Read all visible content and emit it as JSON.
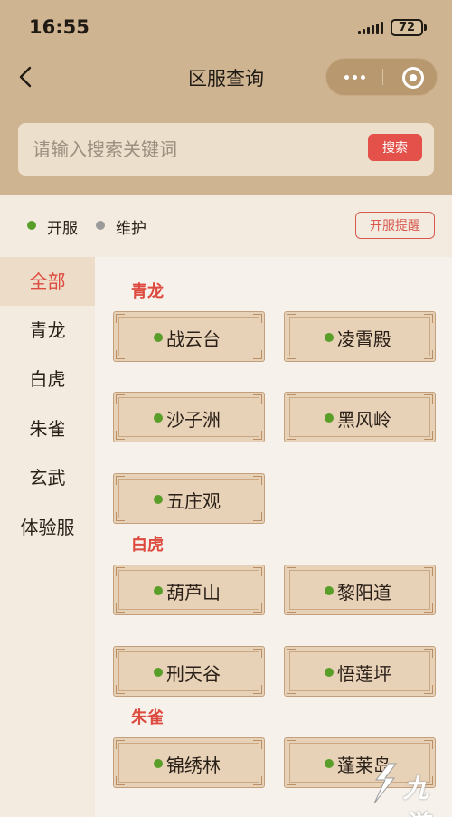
{
  "status_bar": {
    "time": "16:55",
    "battery": "72"
  },
  "nav": {
    "title": "区服查询"
  },
  "search": {
    "placeholder": "请输入搜索关键词",
    "button_label": "搜索"
  },
  "legend": {
    "open_label": "开服",
    "maintenance_label": "维护",
    "remind_label": "开服提醒"
  },
  "colors": {
    "open": "#5a9e2a",
    "maintenance": "#9a9a9a",
    "accent": "#dd4a3f",
    "header": "#cfb492"
  },
  "sidebar": {
    "items": [
      {
        "label": "全部",
        "active": true
      },
      {
        "label": "青龙"
      },
      {
        "label": "白虎"
      },
      {
        "label": "朱雀"
      },
      {
        "label": "玄武"
      },
      {
        "label": "体验服"
      }
    ]
  },
  "groups": [
    {
      "title": "青龙",
      "servers": [
        {
          "name": "战云台",
          "status": "open"
        },
        {
          "name": "凌霄殿",
          "status": "open"
        },
        {
          "name": "沙子洲",
          "status": "open"
        },
        {
          "name": "黑风岭",
          "status": "open"
        },
        {
          "name": "五庄观",
          "status": "open"
        }
      ]
    },
    {
      "title": "白虎",
      "servers": [
        {
          "name": "葫芦山",
          "status": "open"
        },
        {
          "name": "黎阳道",
          "status": "open"
        },
        {
          "name": "刑天谷",
          "status": "open"
        },
        {
          "name": "悟莲坪",
          "status": "open"
        }
      ]
    },
    {
      "title": "朱雀",
      "servers": [
        {
          "name": "锦绣林",
          "status": "open"
        },
        {
          "name": "蓬莱岛",
          "status": "open"
        }
      ]
    }
  ],
  "watermark": {
    "text": "九游"
  }
}
